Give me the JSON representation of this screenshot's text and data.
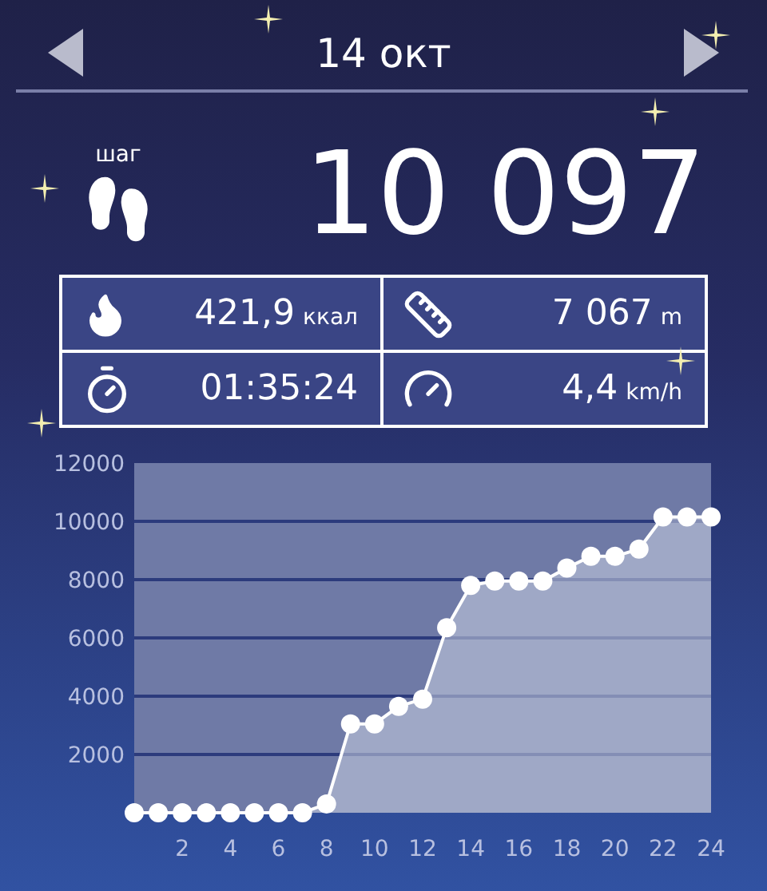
{
  "header": {
    "title": "14 окт"
  },
  "steps": {
    "label": "шаг",
    "value": "10 097"
  },
  "stats": [
    {
      "kind": "calories",
      "value": "421,9",
      "unit": "ккал"
    },
    {
      "kind": "distance",
      "value": "7 067",
      "unit": "m"
    },
    {
      "kind": "duration",
      "value": "01:35:24"
    },
    {
      "kind": "speed",
      "value": "4,4",
      "unit": "km/h"
    }
  ],
  "chart": {
    "chart_data": {
      "type": "area",
      "x": [
        0,
        1,
        2,
        3,
        4,
        5,
        6,
        7,
        8,
        9,
        10,
        11,
        12,
        13,
        14,
        15,
        16,
        17,
        18,
        19,
        20,
        21,
        22,
        23,
        24
      ],
      "series": [
        {
          "color": "#ffffff",
          "values": [
            0,
            0,
            0,
            0,
            0,
            0,
            0,
            0,
            300,
            3050,
            3050,
            3650,
            3900,
            6350,
            7800,
            7950,
            7950,
            7950,
            8400,
            8800,
            8800,
            9050,
            10150,
            10150,
            10150
          ]
        }
      ],
      "grid": true,
      "xlim": [
        0,
        24
      ],
      "ylim": [
        0,
        12000
      ],
      "xticks": [
        2,
        4,
        6,
        8,
        10,
        12,
        14,
        16,
        18,
        20,
        22,
        24
      ],
      "yticks": [
        2000,
        4000,
        6000,
        8000,
        10000,
        12000
      ]
    }
  }
}
